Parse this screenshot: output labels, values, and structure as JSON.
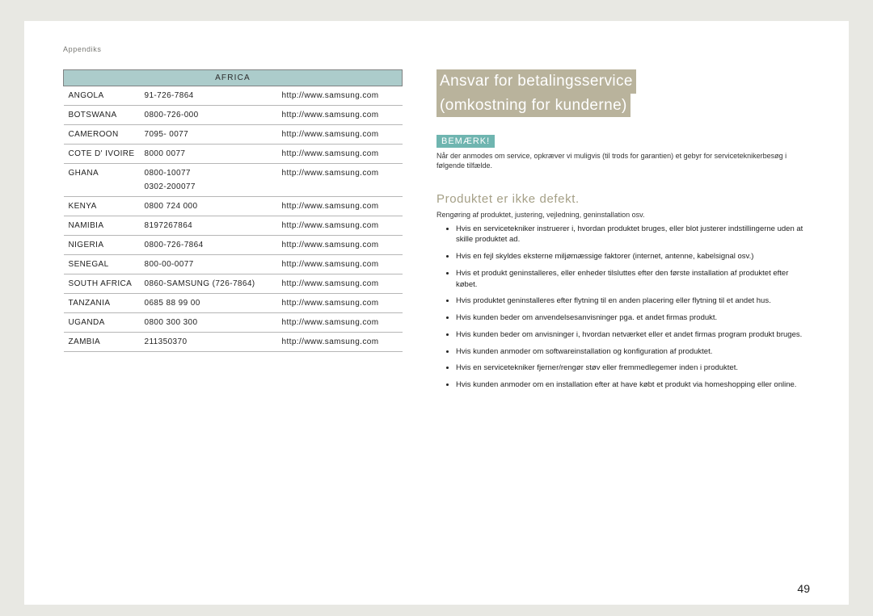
{
  "breadcrumb": "Appendiks",
  "page_number": "49",
  "table": {
    "header": "AFRICA",
    "rows": [
      {
        "country": "ANGOLA",
        "phone": "91-726-7864",
        "url": "http://www.samsung.com"
      },
      {
        "country": "BOTSWANA",
        "phone": "0800-726-000",
        "url": "http://www.samsung.com"
      },
      {
        "country": "CAMEROON",
        "phone": "7095- 0077",
        "url": "http://www.samsung.com"
      },
      {
        "country": "COTE D' IVOIRE",
        "phone": "8000 0077",
        "url": "http://www.samsung.com"
      },
      {
        "country": "GHANA",
        "phone": "0800-10077",
        "phone2": "0302-200077",
        "url": "http://www.samsung.com"
      },
      {
        "country": "KENYA",
        "phone": "0800 724 000",
        "url": "http://www.samsung.com"
      },
      {
        "country": "NAMIBIA",
        "phone": "8197267864",
        "url": "http://www.samsung.com"
      },
      {
        "country": "NIGERIA",
        "phone": "0800-726-7864",
        "url": "http://www.samsung.com"
      },
      {
        "country": "SENEGAL",
        "phone": "800-00-0077",
        "url": "http://www.samsung.com"
      },
      {
        "country": "SOUTH AFRICA",
        "phone": "0860-SAMSUNG (726-7864)",
        "url": "http://www.samsung.com"
      },
      {
        "country": "TANZANIA",
        "phone": "0685 88 99 00",
        "url": "http://www.samsung.com"
      },
      {
        "country": "UGANDA",
        "phone": "0800 300 300",
        "url": "http://www.samsung.com"
      },
      {
        "country": "ZAMBIA",
        "phone": "211350370",
        "url": "http://www.samsung.com"
      }
    ]
  },
  "heading": {
    "line1": "Ansvar for betalingsservice",
    "line2": "(omkostning for kunderne)"
  },
  "note": {
    "badge": "BEMÆRK!",
    "text": "Når der anmodes om service, opkræver vi muligvis (til trods for garantien) et gebyr for serviceteknikerbesøg i følgende tilfælde."
  },
  "section": {
    "title": "Produktet er ikke defekt.",
    "lead": "Rengøring af produktet, justering, vejledning, geninstallation osv.",
    "bullets": [
      "Hvis en servicetekniker instruerer i, hvordan produktet bruges, eller blot justerer indstillingerne uden at skille produktet ad.",
      "Hvis en fejl skyldes eksterne miljømæssige faktorer (internet, antenne, kabelsignal osv.)",
      "Hvis et produkt geninstalleres, eller enheder tilsluttes efter den første installation af produktet efter købet.",
      "Hvis produktet geninstalleres efter flytning til en anden placering eller flytning til et andet hus.",
      "Hvis kunden beder om anvendelsesanvisninger pga. et andet firmas produkt.",
      "Hvis kunden beder om anvisninger i, hvordan netværket eller et andet firmas program produkt bruges.",
      "Hvis kunden anmoder om softwareinstallation og konfiguration af produktet.",
      "Hvis en servicetekniker fjerner/rengør støv eller fremmedlegemer inden i produktet.",
      "Hvis kunden anmoder om en installation efter at have købt et produkt via homeshopping eller online."
    ]
  }
}
